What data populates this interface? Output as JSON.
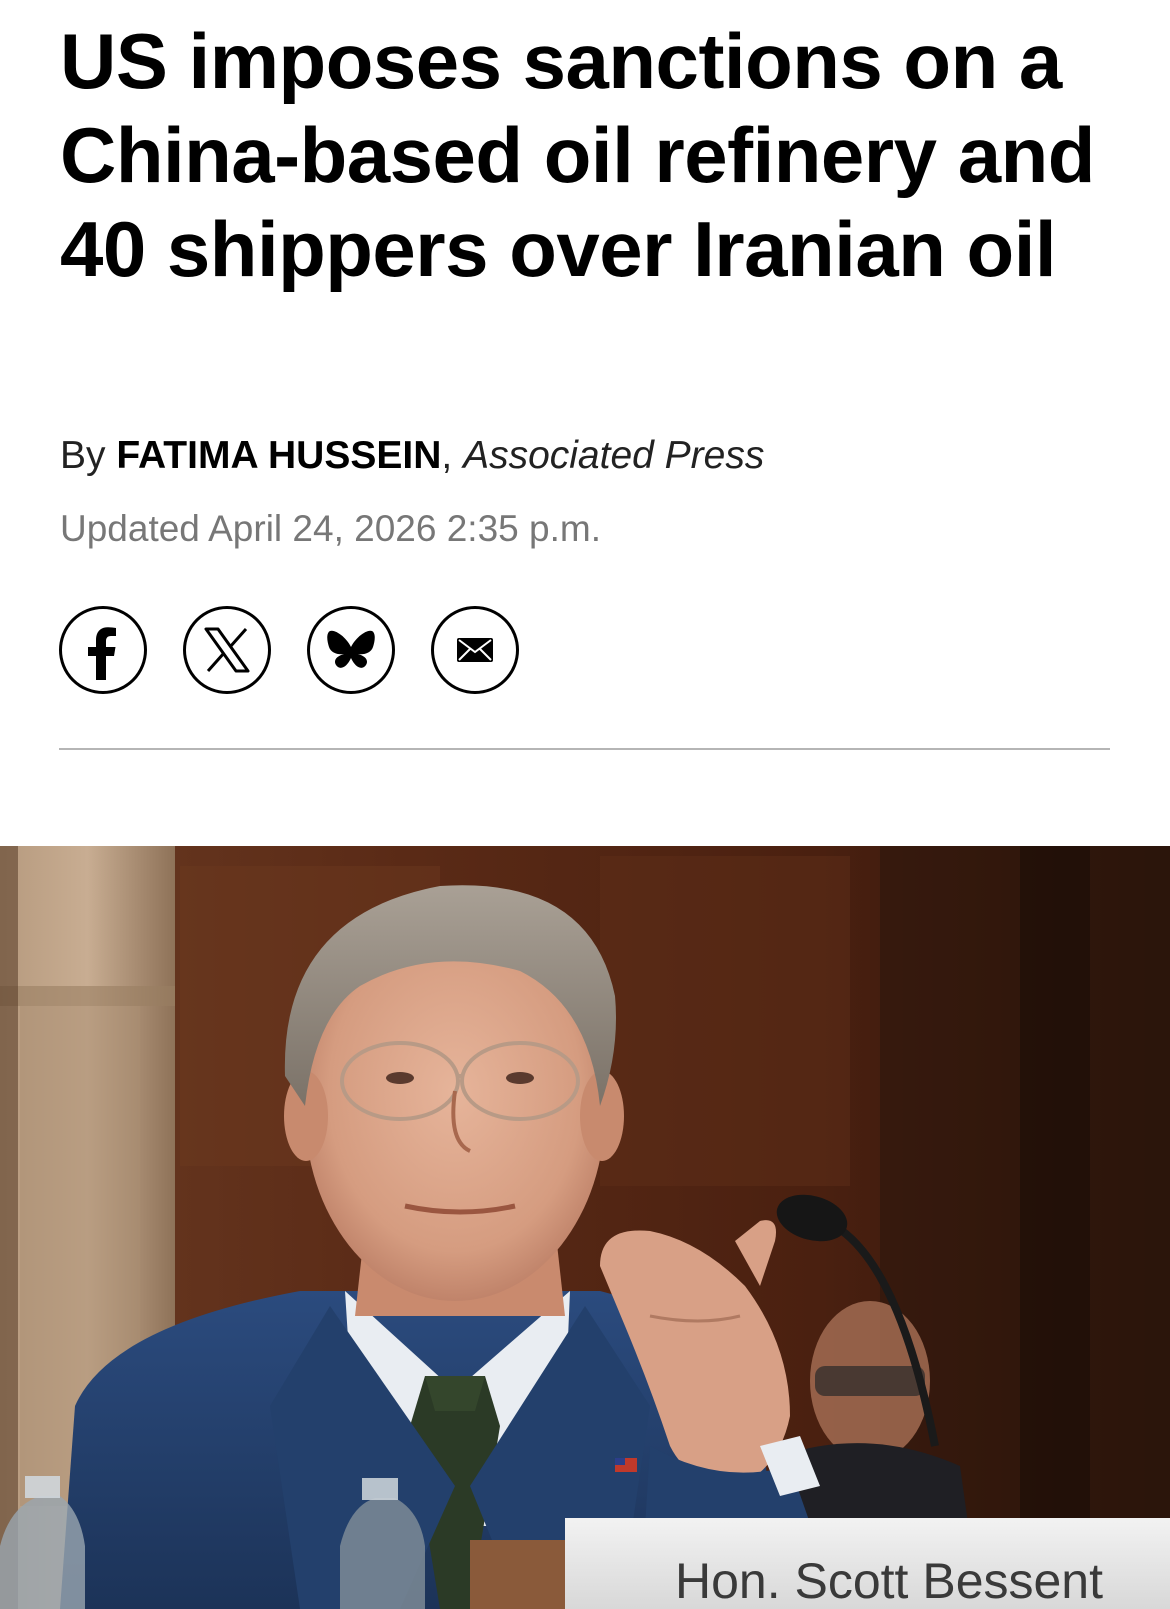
{
  "article": {
    "headline": "US imposes sanctions on a China-based oil refinery and 40 shippers over Iranian oil",
    "byline_prefix": "By",
    "author": "FATIMA HUSSEIN",
    "byline_separator": ",",
    "organization": "Associated Press",
    "timestamp": "Updated April 24, 2026 2:35 p.m."
  },
  "share": {
    "buttons": [
      {
        "icon": "facebook-icon"
      },
      {
        "icon": "x-icon"
      },
      {
        "icon": "bluesky-icon"
      },
      {
        "icon": "email-icon"
      }
    ]
  },
  "photo": {
    "placard_text": "Hon. Scott Bessent"
  },
  "colors": {
    "text": "#000000",
    "muted": "#777777",
    "divider": "#b5b5b5"
  }
}
